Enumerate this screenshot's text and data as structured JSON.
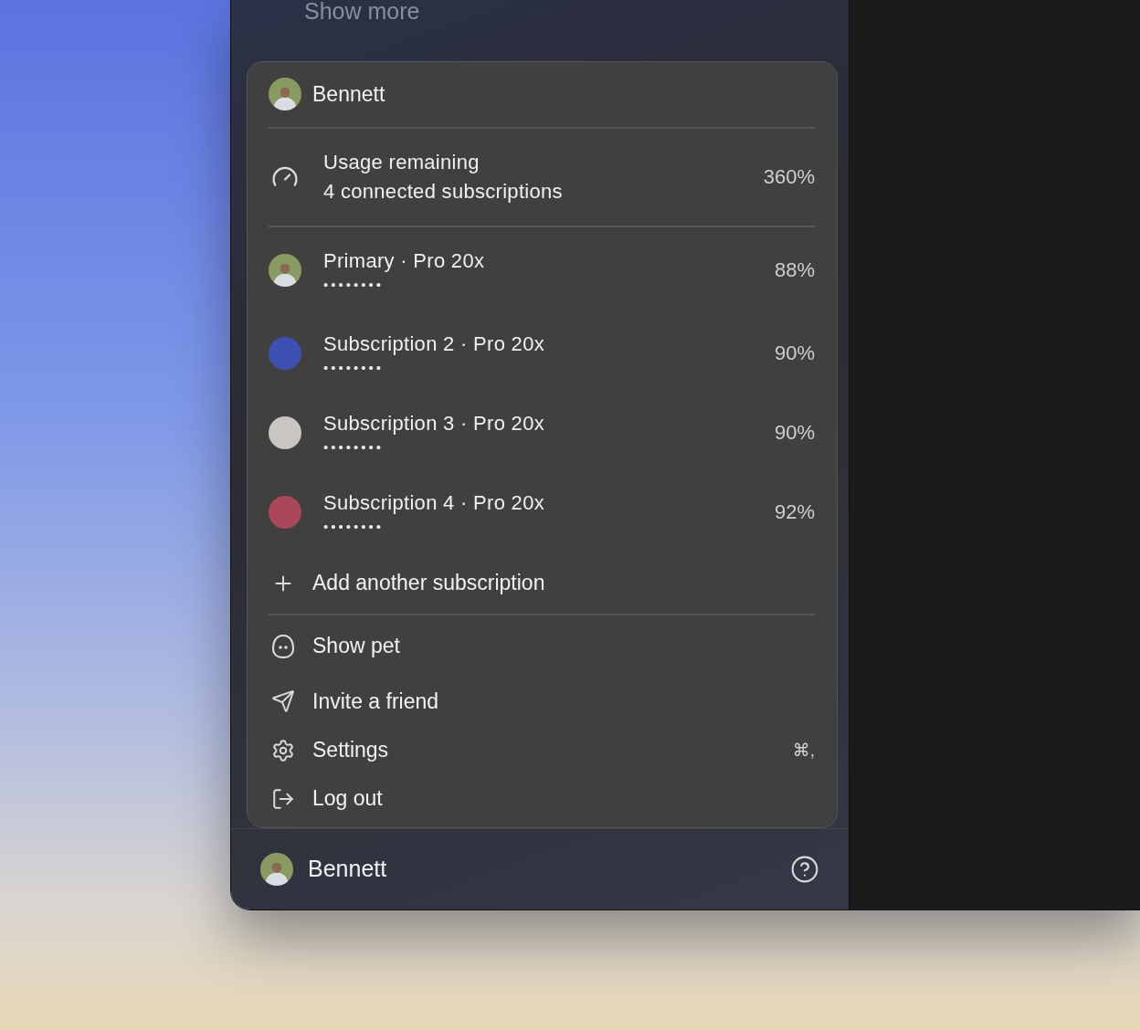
{
  "sidebar": {
    "show_more": "Show more"
  },
  "account_menu": {
    "user": {
      "name": "Bennett"
    },
    "usage": {
      "title": "Usage remaining",
      "subtitle": "4 connected subscriptions",
      "value": "360%"
    },
    "subscriptions": [
      {
        "kind": "avatar",
        "name": "Primary · Pro 20x",
        "account": "••••••••",
        "value": "88%"
      },
      {
        "kind": "dot",
        "color": "#3d4fb0",
        "name": "Subscription 2 · Pro 20x",
        "account": "••••••••",
        "value": "90%"
      },
      {
        "kind": "dot",
        "color": "#c9c5c0",
        "name": "Subscription 3 · Pro 20x",
        "account": "••••••••",
        "value": "90%"
      },
      {
        "kind": "dot",
        "color": "#a8485a",
        "name": "Subscription 4 · Pro 20x",
        "account": "••••••••",
        "value": "92%"
      }
    ],
    "add_subscription": "Add another subscription",
    "items": [
      {
        "kind": "pet",
        "label": "Show pet"
      },
      {
        "kind": "invite",
        "label": "Invite a friend"
      },
      {
        "kind": "settings",
        "label": "Settings",
        "shortcut": "⌘,"
      },
      {
        "kind": "logout",
        "label": "Log out"
      }
    ]
  },
  "footer": {
    "user": "Bennett"
  }
}
